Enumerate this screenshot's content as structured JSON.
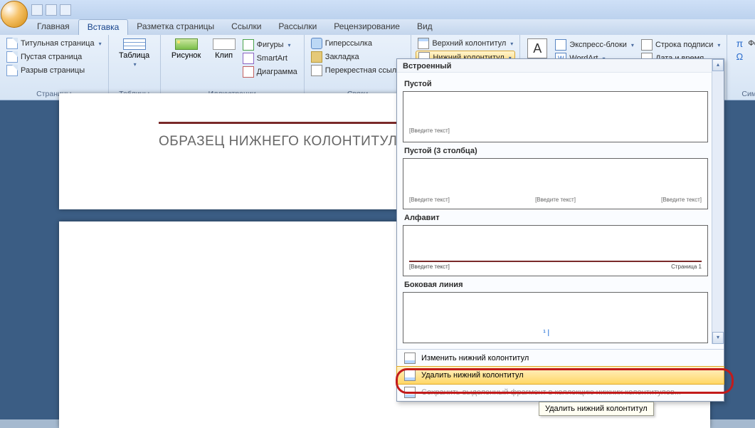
{
  "tabs": {
    "home": "Главная",
    "insert": "Вставка",
    "layout": "Разметка страницы",
    "refs": "Ссылки",
    "mail": "Рассылки",
    "review": "Рецензирование",
    "view": "Вид"
  },
  "groups": {
    "pages": {
      "label": "Страницы",
      "cover": "Титульная страница",
      "blank": "Пустая страница",
      "break": "Разрыв страницы"
    },
    "tables": {
      "label": "Таблицы",
      "table": "Таблица"
    },
    "illustrations": {
      "label": "Иллюстрации",
      "picture": "Рисунок",
      "clip": "Клип",
      "shapes": "Фигуры",
      "smartart": "SmartArt",
      "chart": "Диаграмма"
    },
    "links": {
      "label": "Связи",
      "hyperlink": "Гиперссылка",
      "bookmark": "Закладка",
      "crossref": "Перекрестная ссылка"
    },
    "headerfooter": {
      "header": "Верхний колонтитул",
      "footer": "Нижний колонтитул"
    },
    "text": {
      "textbox": "A",
      "quickparts": "Экспресс-блоки",
      "wordart": "WordArt",
      "signature": "Строка подписи",
      "datetime": "Дата и время"
    },
    "symbols": {
      "label": "Симв",
      "formula": "Форм"
    }
  },
  "document": {
    "heading": "ОБРАЗЕЦ НИЖНЕГО КОЛОНТИТУЛА"
  },
  "gallery": {
    "section": "Встроенный",
    "empty": "Пустой",
    "empty3": "Пустой (3 столбца)",
    "alphabet": "Алфавит",
    "sideline": "Боковая линия",
    "placeholder": "[Введите текст]",
    "pageN": "Страница 1",
    "edit": "Изменить нижний колонтитул",
    "remove": "Удалить нижний колонтитул",
    "save_disabled": "Сохранить выделенный фрагмент в коллекцию нижних колонтитулов..."
  },
  "tooltip": "Удалить нижний колонтитул"
}
